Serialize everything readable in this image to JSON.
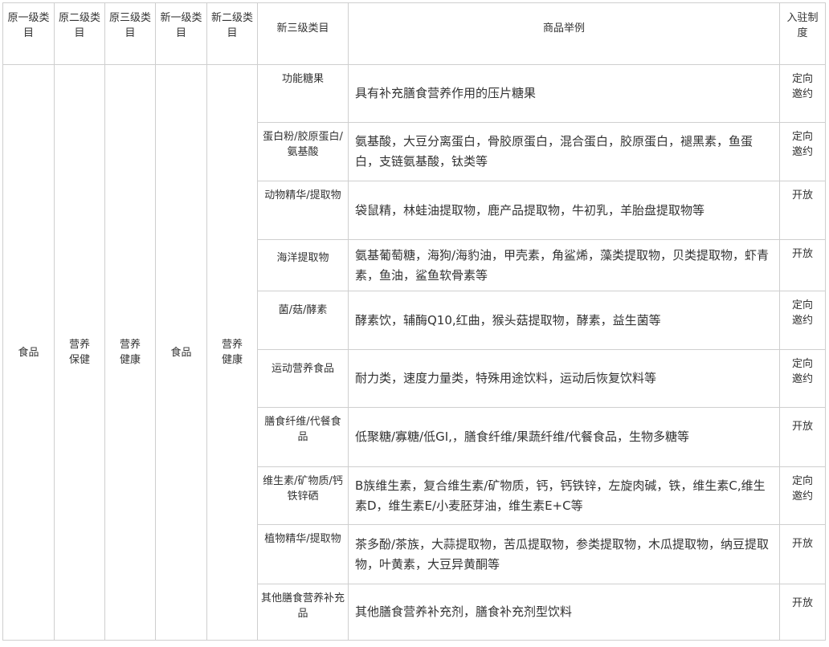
{
  "headers": {
    "orig_l1": "原一级类目",
    "orig_l2": "原二级类目",
    "orig_l3": "原三级类目",
    "new_l1": "新一级类目",
    "new_l2": "新二级类目",
    "new_l3": "新三级类目",
    "examples": "商品举例",
    "policy": "入驻制度"
  },
  "merged": {
    "orig_l1": "食品",
    "orig_l2": "营养保健",
    "orig_l3": "营养健康",
    "new_l1": "食品",
    "new_l2": "营养健康"
  },
  "rows": [
    {
      "category": "功能糖果",
      "examples": "具有补充膳食营养作用的压片糖果",
      "policy": "定向邀约"
    },
    {
      "category": "蛋白粉/胶原蛋白/氨基酸",
      "examples": "氨基酸，大豆分离蛋白，骨胶原蛋白，混合蛋白，胶原蛋白，褪黑素，鱼蛋白，支链氨基酸，钛类等",
      "policy": "定向邀约"
    },
    {
      "category": "动物精华/提取物",
      "examples": "袋鼠精，林蛙油提取物，鹿产品提取物，牛初乳，羊胎盘提取物等",
      "policy": "开放"
    },
    {
      "category": "海洋提取物",
      "examples": "氨基葡萄糖，海狗/海豹油，甲壳素，角鲨烯，藻类提取物，贝类提取物，虾青素，鱼油，鲨鱼软骨素等",
      "policy": "开放"
    },
    {
      "category": "菌/菇/酵素",
      "examples": "酵素饮，辅酶Q10,红曲，猴头菇提取物，酵素，益生菌等",
      "policy": "定向邀约"
    },
    {
      "category": "运动营养食品",
      "examples": "耐力类，速度力量类，特殊用途饮料，运动后恢复饮料等",
      "policy": "定向邀约"
    },
    {
      "category": "膳食纤维/代餐食品",
      "examples": "低聚糖/寡糖/低GI,，膳食纤维/果蔬纤维/代餐食品，生物多糖等",
      "policy": "开放"
    },
    {
      "category": "维生素/矿物质/钙铁锌硒",
      "examples": "B族维生素，复合维生素/矿物质，钙，钙铁锌，左旋肉碱，铁，维生素C,维生素D，维生素E/小麦胚芽油，维生素E+C等",
      "policy": "定向邀约"
    },
    {
      "category": "植物精华/提取物",
      "examples": "茶多酚/茶族，大蒜提取物，苦瓜提取物，参类提取物，木瓜提取物，纳豆提取物，叶黄素，大豆异黄酮等",
      "policy": "开放"
    },
    {
      "category": "其他膳食营养补充品",
      "examples": "其他膳食营养补充剂，膳食补充剂型饮料",
      "policy": "开放"
    }
  ]
}
